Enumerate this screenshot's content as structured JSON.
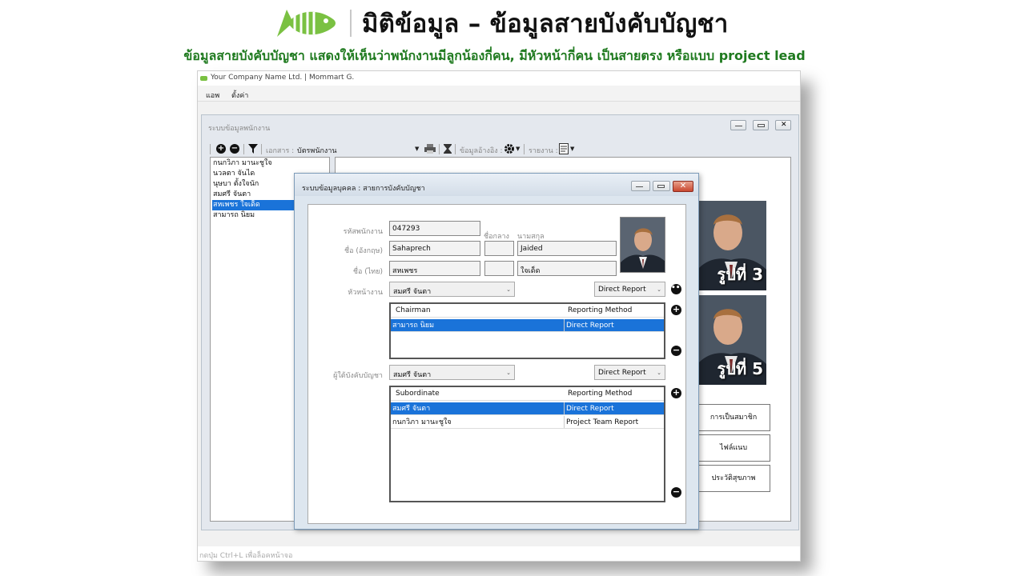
{
  "header": {
    "title": "มิติข้อมูล – ข้อมูลสายบังคับบัญชา",
    "subtitle": "ข้อมูลสายบังคับบัญชา แสดงให้เห็นว่าพนักงานมีลูกน้องกี่คน, มีหัวหน้ากี่คน เป็นสายตรง หรือแบบ project lead",
    "logo_icon": "fish-logo-icon",
    "brand_color": "#7ac142"
  },
  "app": {
    "window_title": "Your Company Name Ltd. | Mommart G.",
    "menu": [
      "แอพ",
      "ตั้งค่า"
    ],
    "status_text": "กดปุ่ม Ctrl+L เพื่อล็อคหน้าจอ"
  },
  "employee_window": {
    "title": "ระบบข้อมูลพนักงาน",
    "toolbar": {
      "document_label": "เอกสาร :",
      "document_value": "บัตรพนักงาน",
      "reference_label": "ข้อมูลอ้างอิง :",
      "report_label": "รายงาน :"
    },
    "employees": [
      "กนกวิภา มานะชูใจ",
      "นวลตา จันได",
      "นุษบา ตั้งใจนัก",
      "สมศรี จันตา",
      "สหเพชร ใจเด็ด",
      "สามารถ นิยม"
    ],
    "selected_index": 4,
    "photos": [
      "รูปที่ 3",
      "รูปที่ 5"
    ],
    "side_buttons": [
      "การเป็นสมาชิก",
      "ไฟล์แนบ",
      "ประวัติสุขภาพ"
    ]
  },
  "dialog": {
    "title": "ระบบข้อมูลบุคคล : สายการบังคับบัญชา",
    "labels": {
      "employee_code": "รหัสพนักงาน",
      "middle_name": "ชื่อกลาง",
      "last_name": "นามสกุล",
      "name_en": "ชื่อ (อังกฤษ)",
      "name_th": "ชื่อ (ไทย)",
      "supervisor": "หัวหน้างาน",
      "subordinate": "ผู้ใต้บังคับบัญชา"
    },
    "values": {
      "employee_code": "047293",
      "first_name_en": "Sahaprech",
      "middle_name_en": "",
      "last_name_en": "Jaided",
      "first_name_th": "สหเพชร",
      "middle_name_th": "",
      "last_name_th": "ใจเด็ด",
      "supervisor_select": "สมศรี จันตา",
      "supervisor_method": "Direct Report",
      "subordinate_select": "สมศรี จันตา",
      "subordinate_method": "Direct Report"
    },
    "chairman_grid": {
      "headers": [
        "Chairman",
        "Reporting Method"
      ],
      "rows": [
        [
          "สามารถ นิยม",
          "Direct Report"
        ]
      ]
    },
    "subordinate_grid": {
      "headers": [
        "Subordinate",
        "Reporting Method"
      ],
      "rows": [
        [
          "สมศรี จันตา",
          "Direct Report"
        ],
        [
          "กนกวิภา มานะชูใจ",
          "Project Team Report"
        ]
      ]
    },
    "selection_color": "#1a73d9"
  }
}
